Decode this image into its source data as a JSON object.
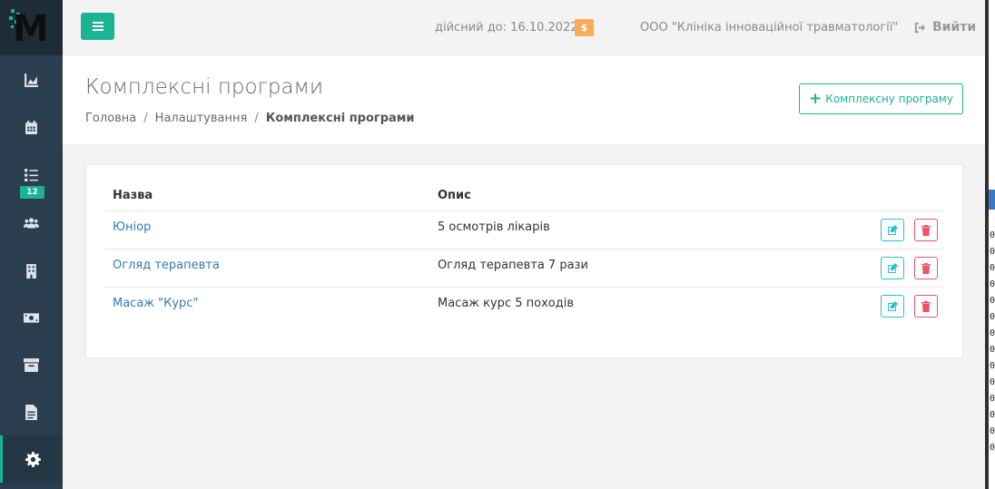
{
  "sidebar": {
    "logo": "M",
    "badge": "12",
    "items": [
      "chart-icon",
      "calendar-icon",
      "list-icon",
      "users-icon",
      "building-icon",
      "money-icon",
      "archive-icon",
      "document-icon",
      "gear-icon"
    ]
  },
  "topbar": {
    "valid_until": "дійсний до: 16.10.2022",
    "dollar": "$",
    "company": "ООО \"Клініка інноваційної травматології\"",
    "logout": "Вийти"
  },
  "heading": {
    "title": "Комплексні програми",
    "breadcrumb": [
      "Головна",
      "Налаштування",
      "Комплексні програми"
    ],
    "add_button": "Комплексну програму"
  },
  "table": {
    "columns": [
      "Назва",
      "Опис"
    ],
    "rows": [
      {
        "name": "Юніор",
        "description": "5 осмотрів лікарів"
      },
      {
        "name": "Огляд терапевта",
        "description": "Огляд терапевта 7 рази"
      },
      {
        "name": "Масаж \"Курс\"",
        "description": "Масаж курс 5 походів"
      }
    ]
  },
  "right_edge_digits": [
    "0",
    "0",
    "0",
    "0",
    "0",
    "0",
    "0",
    "0",
    "0",
    "0",
    "0",
    "0",
    "0",
    "0"
  ],
  "colors": {
    "accent": "#1ab394",
    "sidebar": "#2b3e4f",
    "warning": "#f8ac59",
    "danger": "#ed5565",
    "info": "#23c6c8",
    "link": "#337ab7"
  }
}
